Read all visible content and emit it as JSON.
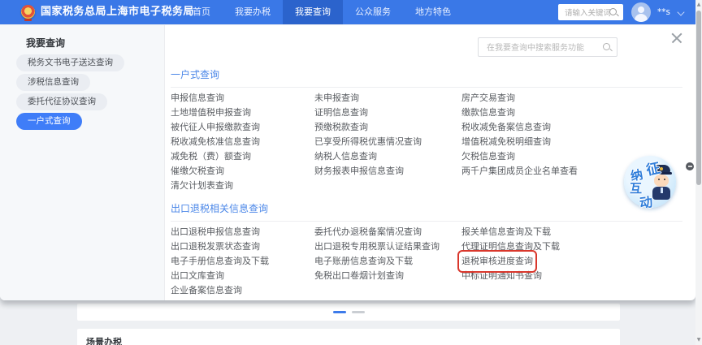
{
  "header": {
    "title": "国家税务总局上海市电子税务局",
    "nav": [
      {
        "label": "首页",
        "active": false
      },
      {
        "label": "我要办税",
        "active": false
      },
      {
        "label": "我要查询",
        "active": true
      },
      {
        "label": "公众服务",
        "active": false
      },
      {
        "label": "地方特色",
        "active": false
      }
    ],
    "search_placeholder": "请输入关键词",
    "user": "**s"
  },
  "sidebar": {
    "title": "我要查询",
    "items": [
      {
        "label": "税务文书电子送达查询",
        "active": false
      },
      {
        "label": "涉税信息查询",
        "active": false
      },
      {
        "label": "委托代征协议查询",
        "active": false
      },
      {
        "label": "一户式查询",
        "active": true
      }
    ]
  },
  "panel": {
    "search_placeholder": "在我要查询中搜索服务功能",
    "sections": [
      {
        "title": "一户式查询",
        "columns": [
          [
            "申报信息查询",
            "土地增值税申报查询",
            "被代征人申报缴款查询",
            "税收减免核准信息查询",
            "减免税（费）额查询",
            "催缴欠税查询",
            "清欠计划表查询"
          ],
          [
            "未申报查询",
            "证明信息查询",
            "预缴税款查询",
            "已享受所得税优惠情况查询",
            "纳税人信息查询",
            "财务报表申报信息查询"
          ],
          [
            "房产交易查询",
            "缴款信息查询",
            "税收减免备案信息查询",
            "增值税减免税明细查询",
            "欠税信息查询",
            "两千户集团成员企业名单查看"
          ]
        ]
      },
      {
        "title": "出口退税相关信息查询",
        "columns": [
          [
            "出口退税申报信息查询",
            "出口退税发票状态查询",
            "电子手册信息查询及下载",
            "出口文库查询",
            "企业备案信息查询"
          ],
          [
            "委托代办退税备案情况查询",
            "出口退税专用税票认证结果查询",
            "电子账册信息查询及下载",
            "免税出口卷烟计划查询"
          ],
          [
            "报关单信息查询及下载",
            "代理证明信息查询及下载",
            {
              "label": "退税审核进度查询",
              "highlighted": true
            },
            "中标证明通知书查询"
          ]
        ]
      }
    ]
  },
  "badge": {
    "name": "征纳互动",
    "chars": [
      "征",
      "纳",
      "互",
      "动"
    ]
  },
  "below": {
    "page_dots": {
      "total": 2,
      "active": 0
    },
    "next_section_title": "场景办税"
  },
  "scrollbar": {
    "up_glyph": "▲",
    "down_glyph": "▼"
  },
  "colors": {
    "header_blue": "#3a78e7",
    "active_nav": "#2b63cc",
    "active_pill": "#3f7df8",
    "section_title": "#4b87e8",
    "link_text": "#595c61",
    "highlight_red": "#d9372c",
    "badge_blue": "#2e7cd9"
  }
}
